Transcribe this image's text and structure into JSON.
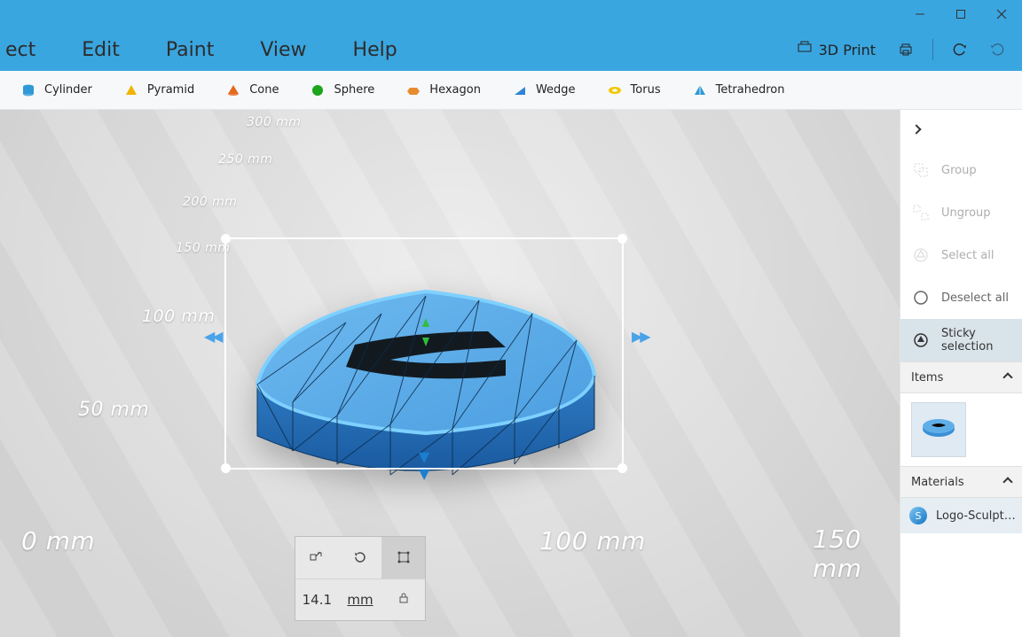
{
  "menu": {
    "items": [
      "ect",
      "Edit",
      "Paint",
      "View",
      "Help"
    ]
  },
  "topright": {
    "print": "3D Print"
  },
  "shapes": [
    {
      "label": "Cylinder",
      "color": "#2f99d6",
      "kind": "cyl"
    },
    {
      "label": "Pyramid",
      "color": "#f0b400",
      "kind": "pyr"
    },
    {
      "label": "Cone",
      "color": "#e46a1f",
      "kind": "cone"
    },
    {
      "label": "Sphere",
      "color": "#1aa51a",
      "kind": "sph"
    },
    {
      "label": "Hexagon",
      "color": "#e78b2f",
      "kind": "hex"
    },
    {
      "label": "Wedge",
      "color": "#2f84d6",
      "kind": "wdg"
    },
    {
      "label": "Torus",
      "color": "#f0c800",
      "kind": "tor"
    },
    {
      "label": "Tetrahedron",
      "color": "#2f99d6",
      "kind": "tet"
    }
  ],
  "rulers": {
    "z": [
      "300 mm",
      "250 mm",
      "200 mm",
      "150 mm",
      "100 mm",
      "50 mm"
    ],
    "x": [
      "0 mm",
      "100 mm",
      "150 mm"
    ]
  },
  "panel": {
    "value": "14.1",
    "unit": "mm"
  },
  "side": {
    "actions": [
      {
        "label": "Group",
        "disabled": true,
        "icon": "group"
      },
      {
        "label": "Ungroup",
        "disabled": true,
        "icon": "ungroup"
      },
      {
        "label": "Select all",
        "disabled": true,
        "icon": "selectall"
      },
      {
        "label": "Deselect all",
        "disabled": false,
        "icon": "deselect"
      },
      {
        "label": "Sticky selection",
        "disabled": false,
        "active": true,
        "icon": "sticky"
      }
    ],
    "items_header": "Items",
    "materials_header": "Materials",
    "material_name": "Logo-Sculpteo.p..."
  }
}
